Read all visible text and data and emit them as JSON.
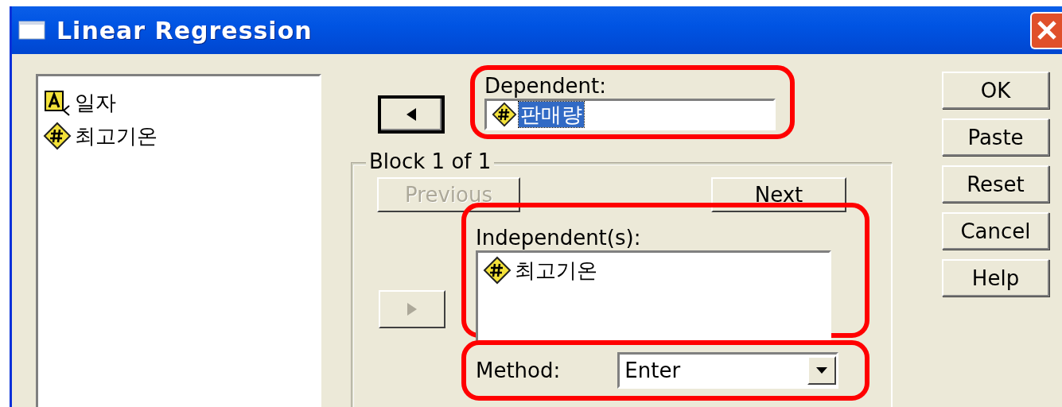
{
  "window": {
    "title": "Linear Regression"
  },
  "variables": [
    {
      "name": "일자",
      "kind": "string"
    },
    {
      "name": "최고기온",
      "kind": "numeric"
    }
  ],
  "move_dependent_button": {
    "kind": "left",
    "focused": true,
    "disabled": false
  },
  "dependent": {
    "label": "Dependent:",
    "highlighted": true,
    "item": {
      "name": "판매량",
      "kind": "numeric",
      "selected": true
    }
  },
  "block": {
    "title": "Block 1 of 1",
    "previous": {
      "label": "Previous",
      "disabled": true
    },
    "next": {
      "label": "Next",
      "disabled": false
    }
  },
  "move_independent_button": {
    "kind": "right",
    "focused": false,
    "disabled": true
  },
  "independents": {
    "label": "Independent(s):",
    "highlighted": true,
    "items": [
      {
        "name": "최고기온",
        "kind": "numeric",
        "selected": false
      }
    ]
  },
  "method": {
    "label": "Method:",
    "value": "Enter",
    "highlighted": true
  },
  "buttons": [
    {
      "label": "OK"
    },
    {
      "label": "Paste"
    },
    {
      "label": "Reset"
    },
    {
      "label": "Cancel"
    },
    {
      "label": "Help"
    }
  ]
}
